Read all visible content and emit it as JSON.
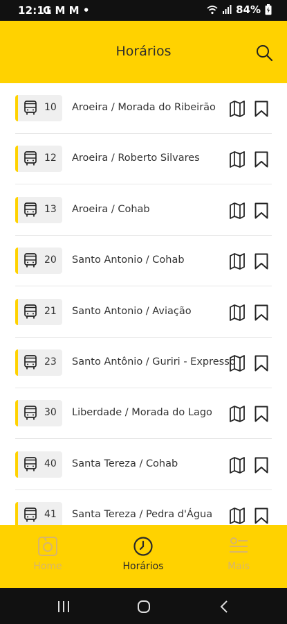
{
  "status_bar": {
    "time": "12:11",
    "left_icons": "G M M •",
    "battery": "84%"
  },
  "header": {
    "title": "Horários"
  },
  "routes": [
    {
      "number": "10",
      "name": "Aroeira / Morada do Ribeirão"
    },
    {
      "number": "12",
      "name": "Aroeira / Roberto Silvares"
    },
    {
      "number": "13",
      "name": "Aroeira / Cohab"
    },
    {
      "number": "20",
      "name": "Santo Antonio / Cohab"
    },
    {
      "number": "21",
      "name": "Santo Antonio / Aviação"
    },
    {
      "number": "23",
      "name": "Santo Antônio / Guriri - Expresso"
    },
    {
      "number": "30",
      "name": "Liberdade / Morada do Lago"
    },
    {
      "number": "40",
      "name": "Santa Tereza / Cohab"
    },
    {
      "number": "41",
      "name": "Santa Tereza / Pedra d'Água"
    }
  ],
  "bottom_nav": {
    "home": "Home",
    "horarios": "Horários",
    "mais": "Mais"
  },
  "colors": {
    "accent": "#FFD200",
    "active_text": "#2a2a2a",
    "inactive_text": "#d7b56c"
  },
  "icons": [
    "search-icon",
    "bus-icon",
    "map-icon",
    "bookmark-icon",
    "home-icon",
    "clock-icon",
    "menu-icon",
    "recents-icon",
    "home-circle-icon",
    "back-icon",
    "wifi-icon",
    "signal-icon",
    "battery-icon"
  ]
}
